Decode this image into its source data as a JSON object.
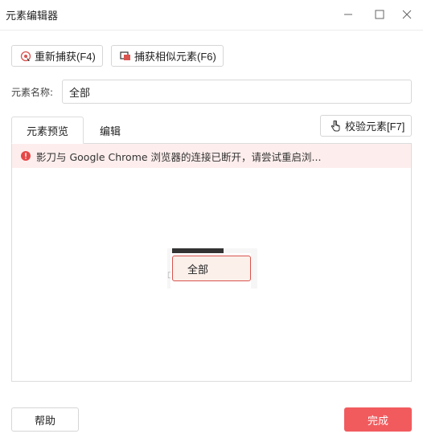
{
  "window": {
    "title": "元素编辑器"
  },
  "toolbar": {
    "capture_label": "重新捕获(F4)",
    "capture_icon": "capture-target-icon",
    "similar_label": "捕获相似元素(F6)",
    "similar_icon": "similar-elements-icon"
  },
  "element_name": {
    "label": "元素名称:",
    "value": "全部"
  },
  "tabs": [
    {
      "label": "元素预览",
      "active": true
    },
    {
      "label": "编辑",
      "active": false
    }
  ],
  "verify": {
    "label": "校验元素[F7]",
    "icon": "pointer-hand-icon"
  },
  "alert": {
    "icon": "error-icon",
    "message": "影刀与 Google Chrome 浏览器的连接已断开，请尝试重启浏..."
  },
  "preview": {
    "selected_text": "全部"
  },
  "footer": {
    "help_label": "帮助",
    "done_label": "完成"
  },
  "colors": {
    "accent": "#f15b5e",
    "alert_bg": "#fdeeed",
    "alert_icon": "#e54848",
    "selection_border": "#d9534f"
  }
}
